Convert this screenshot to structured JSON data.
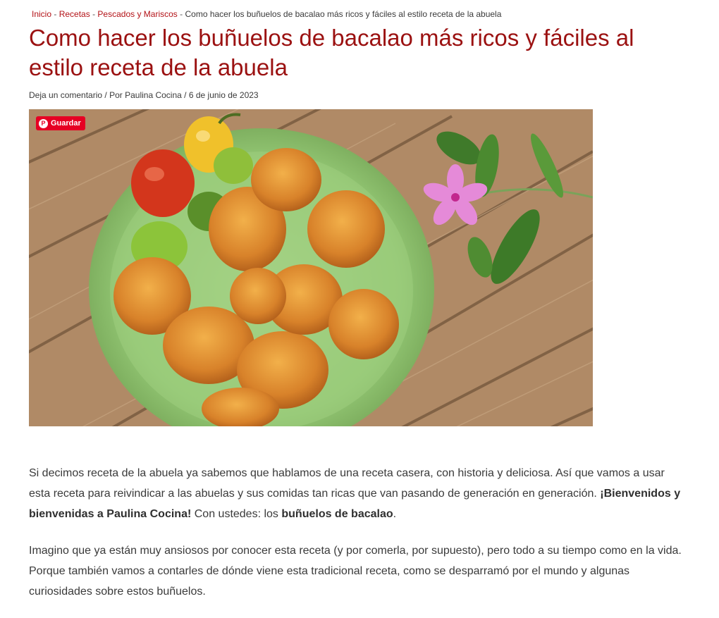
{
  "breadcrumb": {
    "items": [
      "Inicio",
      "Recetas",
      "Pescados y Mariscos"
    ],
    "separator": "-",
    "current": "Como hacer los buñuelos de bacalao más ricos y fáciles al estilo receta de la abuela"
  },
  "article": {
    "title": "Como hacer los buñuelos de bacalao más ricos y fáciles al estilo receta de la abuela",
    "meta": {
      "comment_link": "Deja un comentario",
      "by_prefix": "/ Por",
      "author": "Paulina Cocina",
      "date_prefix": "/",
      "date": "6 de junio de 2023"
    },
    "pin_button": {
      "label": "Guardar",
      "icon": "pinterest-icon",
      "color": "#e60023"
    },
    "paragraphs": [
      {
        "t1": "Si decimos receta de la abuela ya sabemos que hablamos de una receta casera, con historia y deliciosa. Así que vamos a usar esta receta para reivindicar a las abuelas y sus comidas tan ricas que van pasando de generación en generación. ",
        "b1": "¡Bienvenidos y bienvenidas a Paulina Cocina!",
        "t2": " Con ustedes: los ",
        "b2": "buñuelos de bacalao",
        "t3": "."
      },
      {
        "t1": "Imagino que ya están muy ansiosos por conocer esta receta (y por comerla, por supuesto), pero todo a su tiempo como en la vida. Porque también vamos a contarles de dónde viene esta tradicional receta, como se desparramó por el mundo y algunas curiosidades sobre estos buñuelos."
      }
    ]
  },
  "colors": {
    "accent": "#9b1111",
    "link": "#b31217",
    "text": "#3a3a3a"
  }
}
